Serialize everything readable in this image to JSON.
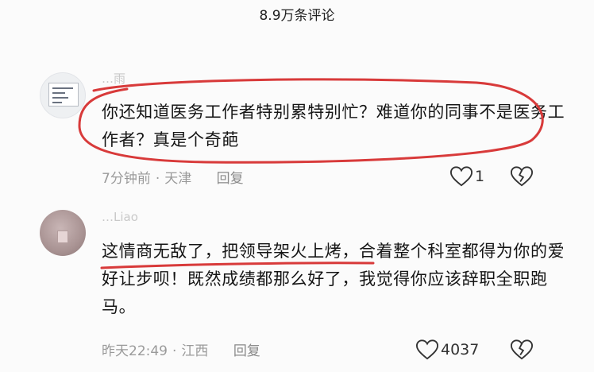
{
  "header": {
    "title": "8.9万条评论"
  },
  "comments": [
    {
      "username": "…雨",
      "text": "你还知道医务工作者特别累特别忙？难道你的同事不是医务工作者？真是个奇葩",
      "time": "7分钟前",
      "location": "天津",
      "reply_label": "回复",
      "likes": "1"
    },
    {
      "username": "…Liao",
      "text": "这情商无敌了，把领导架火上烤，合着整个科室都得为你的爱好让步呗！既然成绩都那么好了，我觉得你应该辞职全职跑马。",
      "time": "昨天22:49",
      "location": "江西",
      "reply_label": "回复",
      "likes": "4037"
    }
  ],
  "annotations": {
    "stroke_color": "#d83a3a",
    "oval_around": "comment-1-text",
    "underline_under": "comment-2-first-clause"
  },
  "icons": {
    "like": "heart-outline-icon",
    "dislike": "broken-heart-icon"
  }
}
